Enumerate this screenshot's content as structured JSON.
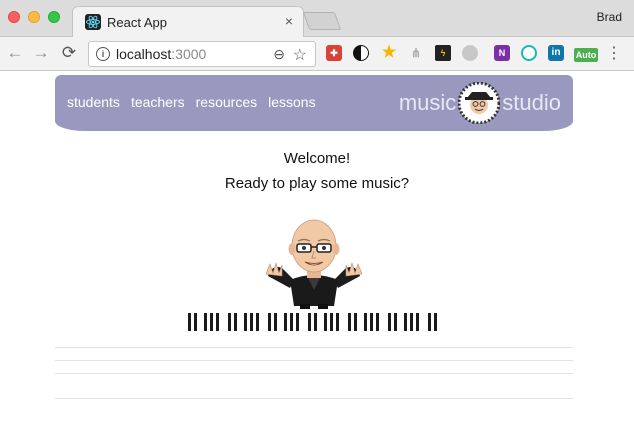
{
  "browser": {
    "tab_title": "React App",
    "tab_close": "×",
    "profile_name": "Brad",
    "url_host": "localhost",
    "url_port": ":3000",
    "nav_back": "←",
    "nav_forward": "→",
    "nav_reload": "⟳",
    "info_glyph": "i",
    "zoom_glyph": "⊖",
    "star_glyph": "☆",
    "menu_glyph": "⋮",
    "extensions": [
      {
        "name": "extension-1-icon",
        "glyph": "✚"
      },
      {
        "name": "contrast-icon",
        "glyph": ""
      },
      {
        "name": "star-extension-icon",
        "glyph": "★"
      },
      {
        "name": "tree-icon",
        "glyph": "⋔"
      },
      {
        "name": "lightning-icon",
        "glyph": "ϟ"
      },
      {
        "name": "grey-circle-icon",
        "glyph": ""
      },
      {
        "name": "onenote-icon",
        "glyph": "N"
      },
      {
        "name": "ring-icon",
        "glyph": ""
      },
      {
        "name": "linkedin-icon",
        "glyph": "in"
      },
      {
        "name": "auto-icon",
        "glyph": "Auto"
      }
    ]
  },
  "header": {
    "nav": [
      "students",
      "teachers",
      "resources",
      "lessons"
    ],
    "logo_left": "music",
    "logo_right": "studio"
  },
  "main": {
    "welcome": "Welcome!",
    "subtitle": "Ready to play some music?"
  },
  "colors": {
    "header_bg": "#9999bf",
    "nav_text": "#ffffff"
  }
}
